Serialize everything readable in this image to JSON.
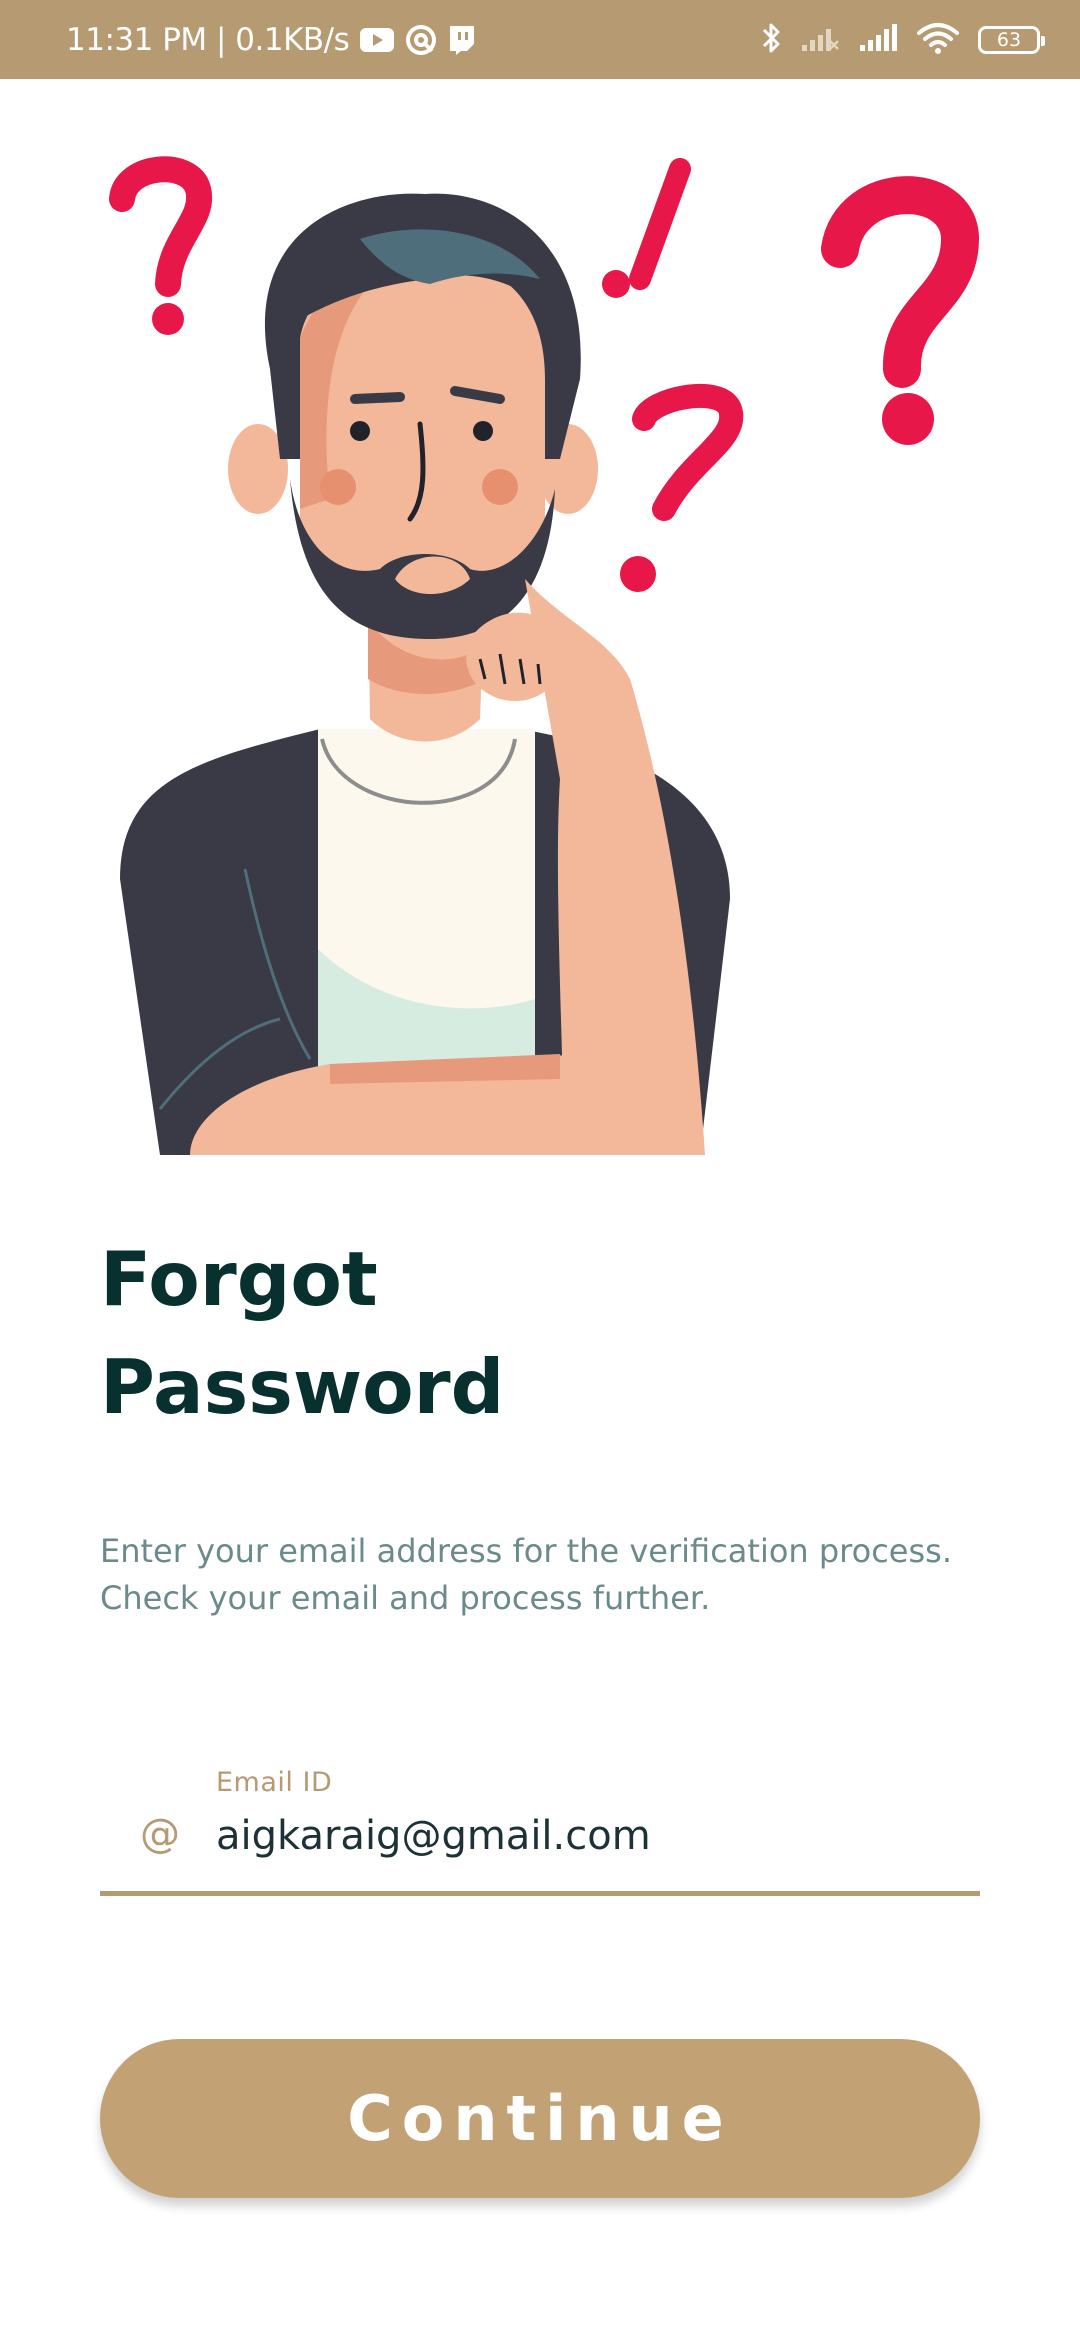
{
  "status_bar": {
    "time_speed": "11:31 PM | 0.1KB/s",
    "battery_level": "63",
    "icons": [
      "youtube-icon",
      "vpn-icon",
      "twitch-icon",
      "bluetooth-icon",
      "signal-weak-icon",
      "signal-icon",
      "wifi-icon",
      "battery-icon"
    ]
  },
  "illustration": {
    "icon": "confused-man-illustration",
    "accent_color": "#e8174a"
  },
  "heading": {
    "line1": "Forgot",
    "line2": "Password"
  },
  "description": {
    "line1": "Enter your email address for the verification process.",
    "line2": "Check your email and process further."
  },
  "email_field": {
    "label": "Email ID",
    "prefix_icon": "@",
    "value": "aigkaraig@gmail.com"
  },
  "continue_button": {
    "label": "Continue"
  },
  "colors": {
    "brand": "#b69a72",
    "button": "#c2a174",
    "heading": "#08302e",
    "description": "#6b8a8c"
  }
}
